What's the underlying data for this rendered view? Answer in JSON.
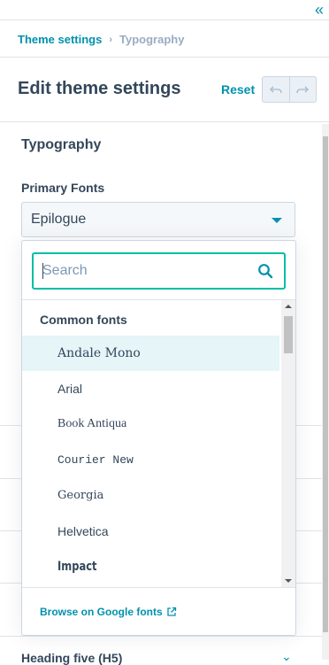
{
  "colors": {
    "accent": "#0091ae",
    "focus": "#00bda5",
    "text": "#33475b",
    "muted": "#99acc2",
    "selected_bg": "#e5f5f8"
  },
  "panel": {
    "collapse_icon": "double-chevron-left-icon",
    "collapse_glyph": "«"
  },
  "breadcrumb": {
    "parent": "Theme settings",
    "separator": "›",
    "current": "Typography"
  },
  "header": {
    "title": "Edit theme settings",
    "reset_label": "Reset",
    "undo_icon": "undo-icon",
    "redo_icon": "redo-icon"
  },
  "section": {
    "title": "Typography",
    "field_label": "Primary Fonts",
    "selected_font": "Epilogue"
  },
  "dropdown": {
    "search_placeholder": "Search",
    "search_value": "",
    "group_label": "Common fonts",
    "fonts": [
      {
        "label": "Andale Mono",
        "selected": true
      },
      {
        "label": "Arial",
        "selected": false
      },
      {
        "label": "Book Antiqua",
        "selected": false
      },
      {
        "label": "Courier New",
        "selected": false
      },
      {
        "label": "Georgia",
        "selected": false
      },
      {
        "label": "Helvetica",
        "selected": false
      },
      {
        "label": "Impact",
        "selected": false
      }
    ],
    "footer_link": "Browse on Google fonts",
    "footer_icon": "external-link-icon"
  },
  "background": {
    "peek_label": "Heading five (H5)"
  }
}
